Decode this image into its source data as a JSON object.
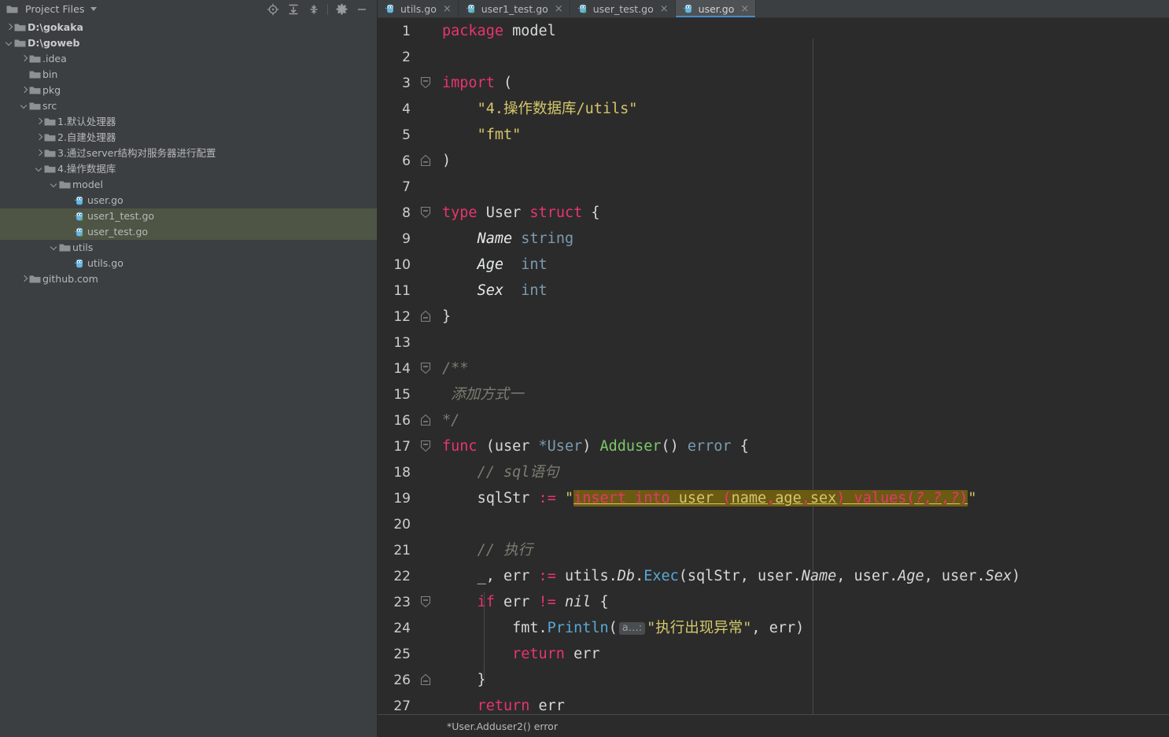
{
  "sidebar": {
    "title": "Project Files",
    "tools": [
      {
        "name": "locate-icon",
        "label": "Select Opened File"
      },
      {
        "name": "expand-all-icon",
        "label": "Expand All"
      },
      {
        "name": "collapse-all-icon",
        "label": "Collapse All"
      },
      {
        "name": "gear-icon",
        "label": "Settings"
      },
      {
        "name": "minimize-icon",
        "label": "Hide"
      }
    ],
    "tree": [
      {
        "label": "D:\\gokaka",
        "depth": 0,
        "arrow": "right",
        "icon": "folder",
        "bold": true,
        "selected": false
      },
      {
        "label": "D:\\goweb",
        "depth": 0,
        "arrow": "down",
        "icon": "folder",
        "bold": true,
        "selected": false
      },
      {
        "label": ".idea",
        "depth": 1,
        "arrow": "right",
        "icon": "folder",
        "bold": false,
        "selected": false
      },
      {
        "label": "bin",
        "depth": 1,
        "arrow": "none",
        "icon": "folder",
        "bold": false,
        "selected": false
      },
      {
        "label": "pkg",
        "depth": 1,
        "arrow": "right",
        "icon": "folder",
        "bold": false,
        "selected": false
      },
      {
        "label": "src",
        "depth": 1,
        "arrow": "down",
        "icon": "folder",
        "bold": false,
        "selected": false
      },
      {
        "label": "1.默认处理器",
        "depth": 2,
        "arrow": "right",
        "icon": "folder",
        "bold": false,
        "selected": false
      },
      {
        "label": "2.自建处理器",
        "depth": 2,
        "arrow": "right",
        "icon": "folder",
        "bold": false,
        "selected": false
      },
      {
        "label": "3.通过server结构对服务器进行配置",
        "depth": 2,
        "arrow": "right",
        "icon": "folder",
        "bold": false,
        "selected": false
      },
      {
        "label": "4.操作数据库",
        "depth": 2,
        "arrow": "down",
        "icon": "folder",
        "bold": false,
        "selected": false
      },
      {
        "label": "model",
        "depth": 3,
        "arrow": "down",
        "icon": "folder",
        "bold": false,
        "selected": false
      },
      {
        "label": "user.go",
        "depth": 4,
        "arrow": "none",
        "icon": "go",
        "bold": false,
        "selected": false
      },
      {
        "label": "user1_test.go",
        "depth": 4,
        "arrow": "none",
        "icon": "gotest",
        "bold": false,
        "selected": true
      },
      {
        "label": "user_test.go",
        "depth": 4,
        "arrow": "none",
        "icon": "gotest",
        "bold": false,
        "selected": true
      },
      {
        "label": "utils",
        "depth": 3,
        "arrow": "down",
        "icon": "folder",
        "bold": false,
        "selected": false
      },
      {
        "label": "utils.go",
        "depth": 4,
        "arrow": "none",
        "icon": "go",
        "bold": false,
        "selected": false
      },
      {
        "label": "github.com",
        "depth": 1,
        "arrow": "right",
        "icon": "folder",
        "bold": false,
        "selected": false
      }
    ]
  },
  "tabs": [
    {
      "label": "utils.go",
      "icon": "go",
      "active": false,
      "close": "×"
    },
    {
      "label": "user1_test.go",
      "icon": "gotest",
      "active": false,
      "close": "×"
    },
    {
      "label": "user_test.go",
      "icon": "gotest",
      "active": false,
      "close": "×"
    },
    {
      "label": "user.go",
      "icon": "go",
      "active": true,
      "close": "×"
    }
  ],
  "editor": {
    "file": "user.go",
    "language": "go",
    "first_line": 1,
    "last_line": 27,
    "lines": [
      {
        "n": 1,
        "fold": "none",
        "html": "<span class=\"kw\">package</span> <span class=\"pln\">model</span>"
      },
      {
        "n": 2,
        "fold": "none",
        "html": ""
      },
      {
        "n": 3,
        "fold": "start",
        "html": "<span class=\"kw\">import</span> <span class=\"pln\">(</span>"
      },
      {
        "n": 4,
        "fold": "none",
        "html": "    <span class=\"str\">\"4.操作数据库/utils\"</span>"
      },
      {
        "n": 5,
        "fold": "none",
        "html": "    <span class=\"str\">\"fmt\"</span>"
      },
      {
        "n": 6,
        "fold": "end",
        "html": "<span class=\"pln\">)</span>"
      },
      {
        "n": 7,
        "fold": "none",
        "html": ""
      },
      {
        "n": 8,
        "fold": "start",
        "html": "<span class=\"kw\">type</span> <span class=\"pln\">User</span> <span class=\"kw\">struct</span> <span class=\"pln\">{</span>"
      },
      {
        "n": 9,
        "fold": "none",
        "html": "    <span class=\"fld\">Name</span> <span class=\"typ\">string</span>"
      },
      {
        "n": 10,
        "fold": "none",
        "html": "    <span class=\"fld\">Age</span>  <span class=\"typ\">int</span>"
      },
      {
        "n": 11,
        "fold": "none",
        "html": "    <span class=\"fld\">Sex</span>  <span class=\"typ\">int</span>"
      },
      {
        "n": 12,
        "fold": "end",
        "html": "<span class=\"pln\">}</span>"
      },
      {
        "n": 13,
        "fold": "none",
        "html": ""
      },
      {
        "n": 14,
        "fold": "start",
        "html": "<span class=\"cmt\">/**</span>"
      },
      {
        "n": 15,
        "fold": "none",
        "html": " <span class=\"cmt\">添加方式一</span>"
      },
      {
        "n": 16,
        "fold": "end",
        "html": "<span class=\"cmt\">*/</span>"
      },
      {
        "n": 17,
        "fold": "start",
        "html": "<span class=\"kw\">func</span> <span class=\"pln\">(user </span><span class=\"typ\">*User</span><span class=\"pln\">) </span><span class=\"fn\">Adduser</span><span class=\"pln\">() </span><span class=\"typ\">error</span><span class=\"pln\"> {</span>"
      },
      {
        "n": 18,
        "fold": "none",
        "html": "    <span class=\"cmt\">// sql语句</span>"
      },
      {
        "n": 19,
        "fold": "none",
        "html": "    <span class=\"pln\">sqlStr</span> <span class=\"kw\">:=</span> <span class=\"str\">\"</span><span class=\"sqlhl\"><span class=\"sqlkw\">insert into </span><span class=\"sqlid\">user</span><span class=\"sqlkw\"> (</span><span class=\"sqlid\">name</span><span class=\"sqlkw\">,</span><span class=\"sqlid\">age</span><span class=\"sqlkw\">,</span><span class=\"sqlid\">sex</span><span class=\"sqlkw\">) values(</span><span class=\"sqlq\">?,?,?</span><span class=\"sqlkw\">)</span></span><span class=\"str\">\"</span>"
      },
      {
        "n": 20,
        "fold": "none",
        "html": ""
      },
      {
        "n": 21,
        "fold": "none",
        "html": "    <span class=\"cmt\">// 执行</span>"
      },
      {
        "n": 22,
        "fold": "none",
        "html": "    <span class=\"pln\">_, err</span> <span class=\"kw\">:=</span> <span class=\"pln\">utils.</span><span class=\"ital\">Db</span><span class=\"pln\">.</span><span class=\"meth\">Exec</span><span class=\"pln\">(sqlStr, user.</span><span class=\"ital\">Name</span><span class=\"pln\">, user.</span><span class=\"ital\">Age</span><span class=\"pln\">, user.</span><span class=\"ital\">Sex</span><span class=\"pln\">)</span>"
      },
      {
        "n": 23,
        "fold": "start",
        "html": "    <span class=\"kw\">if</span> <span class=\"pln\">err</span> <span class=\"kw\">!=</span> <span class=\"ital\">nil</span> <span class=\"pln\">{</span>"
      },
      {
        "n": 24,
        "fold": "none",
        "html": "        <span class=\"pln\">fmt.</span><span class=\"meth\">Println</span><span class=\"pln\">(</span><span class=\"phint\">a…:</span><span class=\"str\">\"执行出现异常\"</span><span class=\"pln\">, err)</span>"
      },
      {
        "n": 25,
        "fold": "none",
        "html": "        <span class=\"kw\">return</span> <span class=\"pln\">err</span>"
      },
      {
        "n": 26,
        "fold": "end",
        "html": "    <span class=\"pln\">}</span>"
      },
      {
        "n": 27,
        "fold": "none",
        "html": "    <span class=\"kw\">return</span> <span class=\"pln\">err</span>"
      }
    ]
  },
  "statusbar": {
    "text": "*User.Adduser2() error"
  },
  "colors": {
    "sidebar_bg": "#3c3f41",
    "editor_bg": "#2b2b2b",
    "selection_bg": "#4e5545",
    "tab_active_bg": "#4e5254",
    "tab_underline": "#4a88c7",
    "keyword": "#e8356d",
    "string": "#d5c76a",
    "comment": "#7c7c72",
    "function": "#7ec86a",
    "method": "#5aa8d6",
    "type": "#7a9cb0",
    "sql_highlight_bg": "#6b5a12"
  }
}
